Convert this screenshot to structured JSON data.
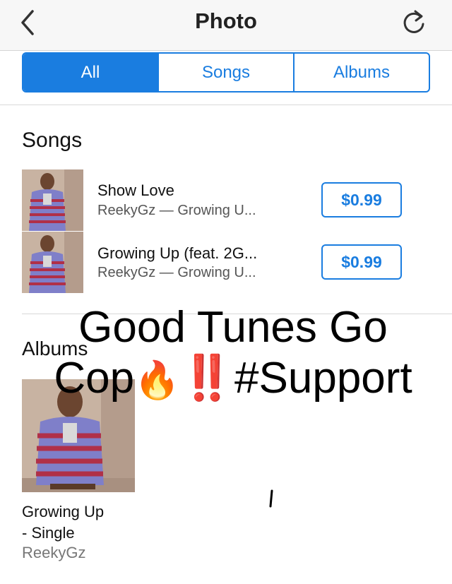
{
  "nav": {
    "title": "Photo",
    "back_icon": "chevron-left-icon",
    "refresh_icon": "refresh-icon"
  },
  "segments": [
    {
      "label": "All",
      "active": true
    },
    {
      "label": "Songs",
      "active": false
    },
    {
      "label": "Albums",
      "active": false
    }
  ],
  "songs_section": {
    "title": "Songs",
    "items": [
      {
        "title": "Show Love",
        "subtitle": "ReekyGz — Growing U...",
        "price": "$0.99"
      },
      {
        "title": "Growing Up (feat. 2G...",
        "subtitle": "ReekyGz — Growing U...",
        "price": "$0.99"
      }
    ]
  },
  "albums_section": {
    "title": "Albums",
    "album": {
      "name_line1": "Growing Up",
      "name_line2": "- Single",
      "artist": "ReekyGz"
    }
  },
  "overlay": {
    "line1": "Good Tunes Go",
    "line2_text1": "Cop",
    "line2_emoji": "🔥",
    "line2_bangs": "‼️",
    "line2_text2": "#Support"
  },
  "colors": {
    "accent": "#1a7de0",
    "nav_bg": "#f7f7f7"
  }
}
